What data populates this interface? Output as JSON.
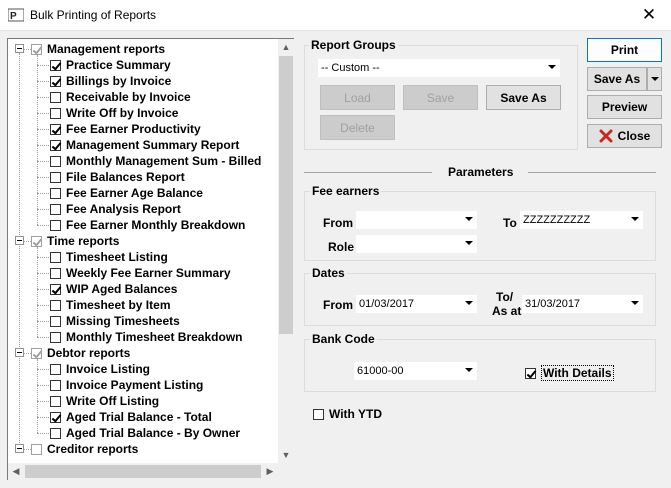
{
  "window": {
    "title": "Bulk Printing of Reports",
    "close_glyph": "✕"
  },
  "tree": {
    "groups": [
      {
        "label": "Management reports",
        "checked": true,
        "items": [
          {
            "label": "Practice Summary",
            "checked": true
          },
          {
            "label": "Billings by Invoice",
            "checked": true
          },
          {
            "label": "Receivable by Invoice",
            "checked": false
          },
          {
            "label": "Write Off by Invoice",
            "checked": false
          },
          {
            "label": "Fee Earner Productivity",
            "checked": true
          },
          {
            "label": "Management Summary Report",
            "checked": true
          },
          {
            "label": "Monthly Management Sum - Billed",
            "checked": false
          },
          {
            "label": "File Balances Report",
            "checked": false
          },
          {
            "label": "Fee Earner Age Balance",
            "checked": false
          },
          {
            "label": "Fee Analysis Report",
            "checked": false
          },
          {
            "label": "Fee Earner Monthly Breakdown",
            "checked": false
          }
        ]
      },
      {
        "label": "Time reports",
        "checked": true,
        "items": [
          {
            "label": "Timesheet Listing",
            "checked": false
          },
          {
            "label": "Weekly Fee Earner Summary",
            "checked": false
          },
          {
            "label": "WIP Aged Balances",
            "checked": true
          },
          {
            "label": "Timesheet by Item",
            "checked": false
          },
          {
            "label": "Missing Timesheets",
            "checked": false
          },
          {
            "label": "Monthly Timesheet Breakdown",
            "checked": false
          }
        ]
      },
      {
        "label": "Debtor reports",
        "checked": true,
        "items": [
          {
            "label": "Invoice Listing",
            "checked": false
          },
          {
            "label": "Invoice Payment Listing",
            "checked": false
          },
          {
            "label": "Write Off Listing",
            "checked": false
          },
          {
            "label": "Aged Trial Balance - Total",
            "checked": true
          },
          {
            "label": "Aged Trial Balance - By Owner",
            "checked": false
          }
        ]
      },
      {
        "label": "Creditor reports",
        "checked": false,
        "items": []
      }
    ]
  },
  "report_groups": {
    "label": "Report Groups",
    "selected": "-- Custom --",
    "load": "Load",
    "save": "Save",
    "save_as": "Save As",
    "delete": "Delete"
  },
  "actions": {
    "print": "Print",
    "save_as": "Save As",
    "preview": "Preview",
    "close": "Close"
  },
  "parameters": {
    "title": "Parameters",
    "fee_earners": {
      "label": "Fee earners",
      "from_label": "From",
      "from_value": "",
      "to_label": "To",
      "to_value": "ZZZZZZZZZZ",
      "role_label": "Role",
      "role_value": ""
    },
    "dates": {
      "label": "Dates",
      "from_label": "From",
      "from_value": "01/03/2017",
      "to_label_1": "To/",
      "to_label_2": "As at",
      "to_value": "31/03/2017"
    },
    "bank": {
      "label": "Bank Code",
      "value": "61000-00",
      "with_details": "With Details",
      "with_details_checked": true
    },
    "with_ytd": "With YTD",
    "with_ytd_checked": false
  },
  "colors": {
    "close_icon": "#c42b1c",
    "window_bg": "#f0f0f0"
  }
}
